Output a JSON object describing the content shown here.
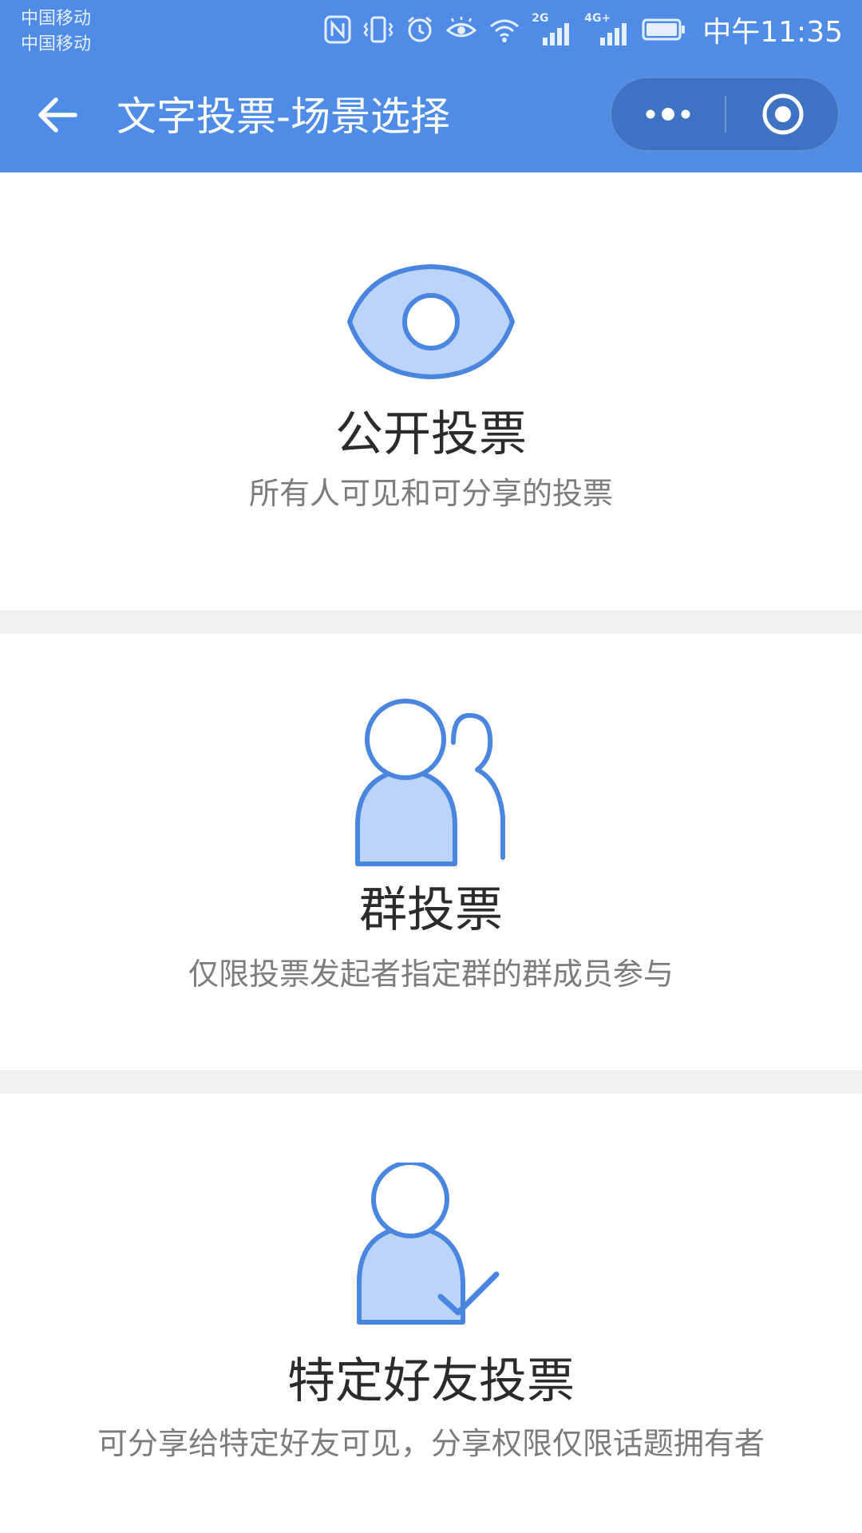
{
  "status_bar": {
    "carrier_1": "中国移动",
    "carrier_2": "中国移动",
    "network_2g": "2G",
    "network_4g": "4G+",
    "time": "中午11:35"
  },
  "nav": {
    "title": "文字投票-场景选择",
    "back_icon": "arrow-left-icon",
    "more_icon": "more-dots-icon",
    "close_icon": "target-circle-icon"
  },
  "options": [
    {
      "icon": "eye-icon",
      "title": "公开投票",
      "description": "所有人可见和可分享的投票"
    },
    {
      "icon": "group-icon",
      "title": "群投票",
      "description": "仅限投票发起者指定群的群成员参与"
    },
    {
      "icon": "user-check-icon",
      "title": "特定好友投票",
      "description": "可分享给特定好友可见，分享权限仅限话题拥有者"
    }
  ],
  "colors": {
    "primary": "#4e8ce8",
    "icon_stroke": "#4a86e0",
    "icon_fill": "#bcd4fb",
    "separator": "#efefef",
    "title_text": "#2b2b2b",
    "desc_text": "#7c7c7c"
  }
}
